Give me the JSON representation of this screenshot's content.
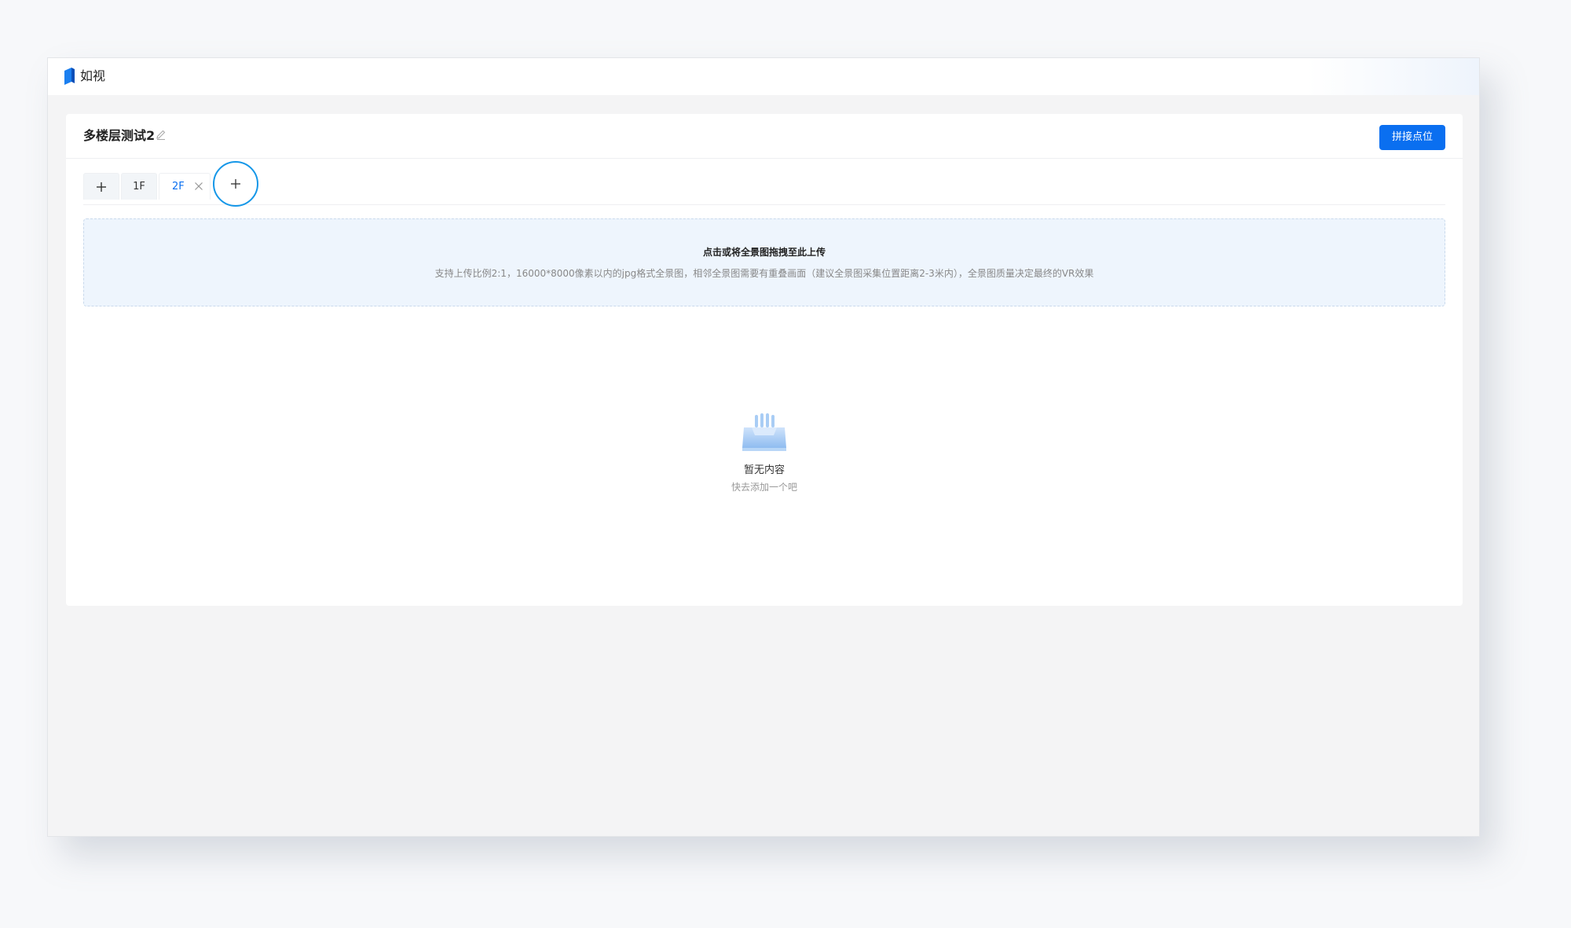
{
  "app": {
    "title": "如视",
    "brand_color": "#0a6ff0",
    "logo_icon": "ruishi-logo-icon"
  },
  "project": {
    "title": "多楼层测试2",
    "edit_icon": "pencil-icon",
    "action_button": "拼接点位"
  },
  "tabs": {
    "add_icon": "plus-icon",
    "floors": [
      {
        "label": "1F",
        "active": false
      },
      {
        "label": "2F",
        "active": true,
        "close_icon": "close-icon"
      }
    ],
    "add_floor_icon": "plus-icon"
  },
  "upload": {
    "title": "点击或将全景图拖拽至此上传",
    "hint": "支持上传比例2:1，16000*8000像素以内的jpg格式全景图，相邻全景图需要有重叠画面（建议全景图采集位置距离2-3米内），全景图质量决定最终的VR效果"
  },
  "empty_state": {
    "icon": "empty-box-icon",
    "title": "暂无内容",
    "subtitle": "快去添加一个吧"
  }
}
